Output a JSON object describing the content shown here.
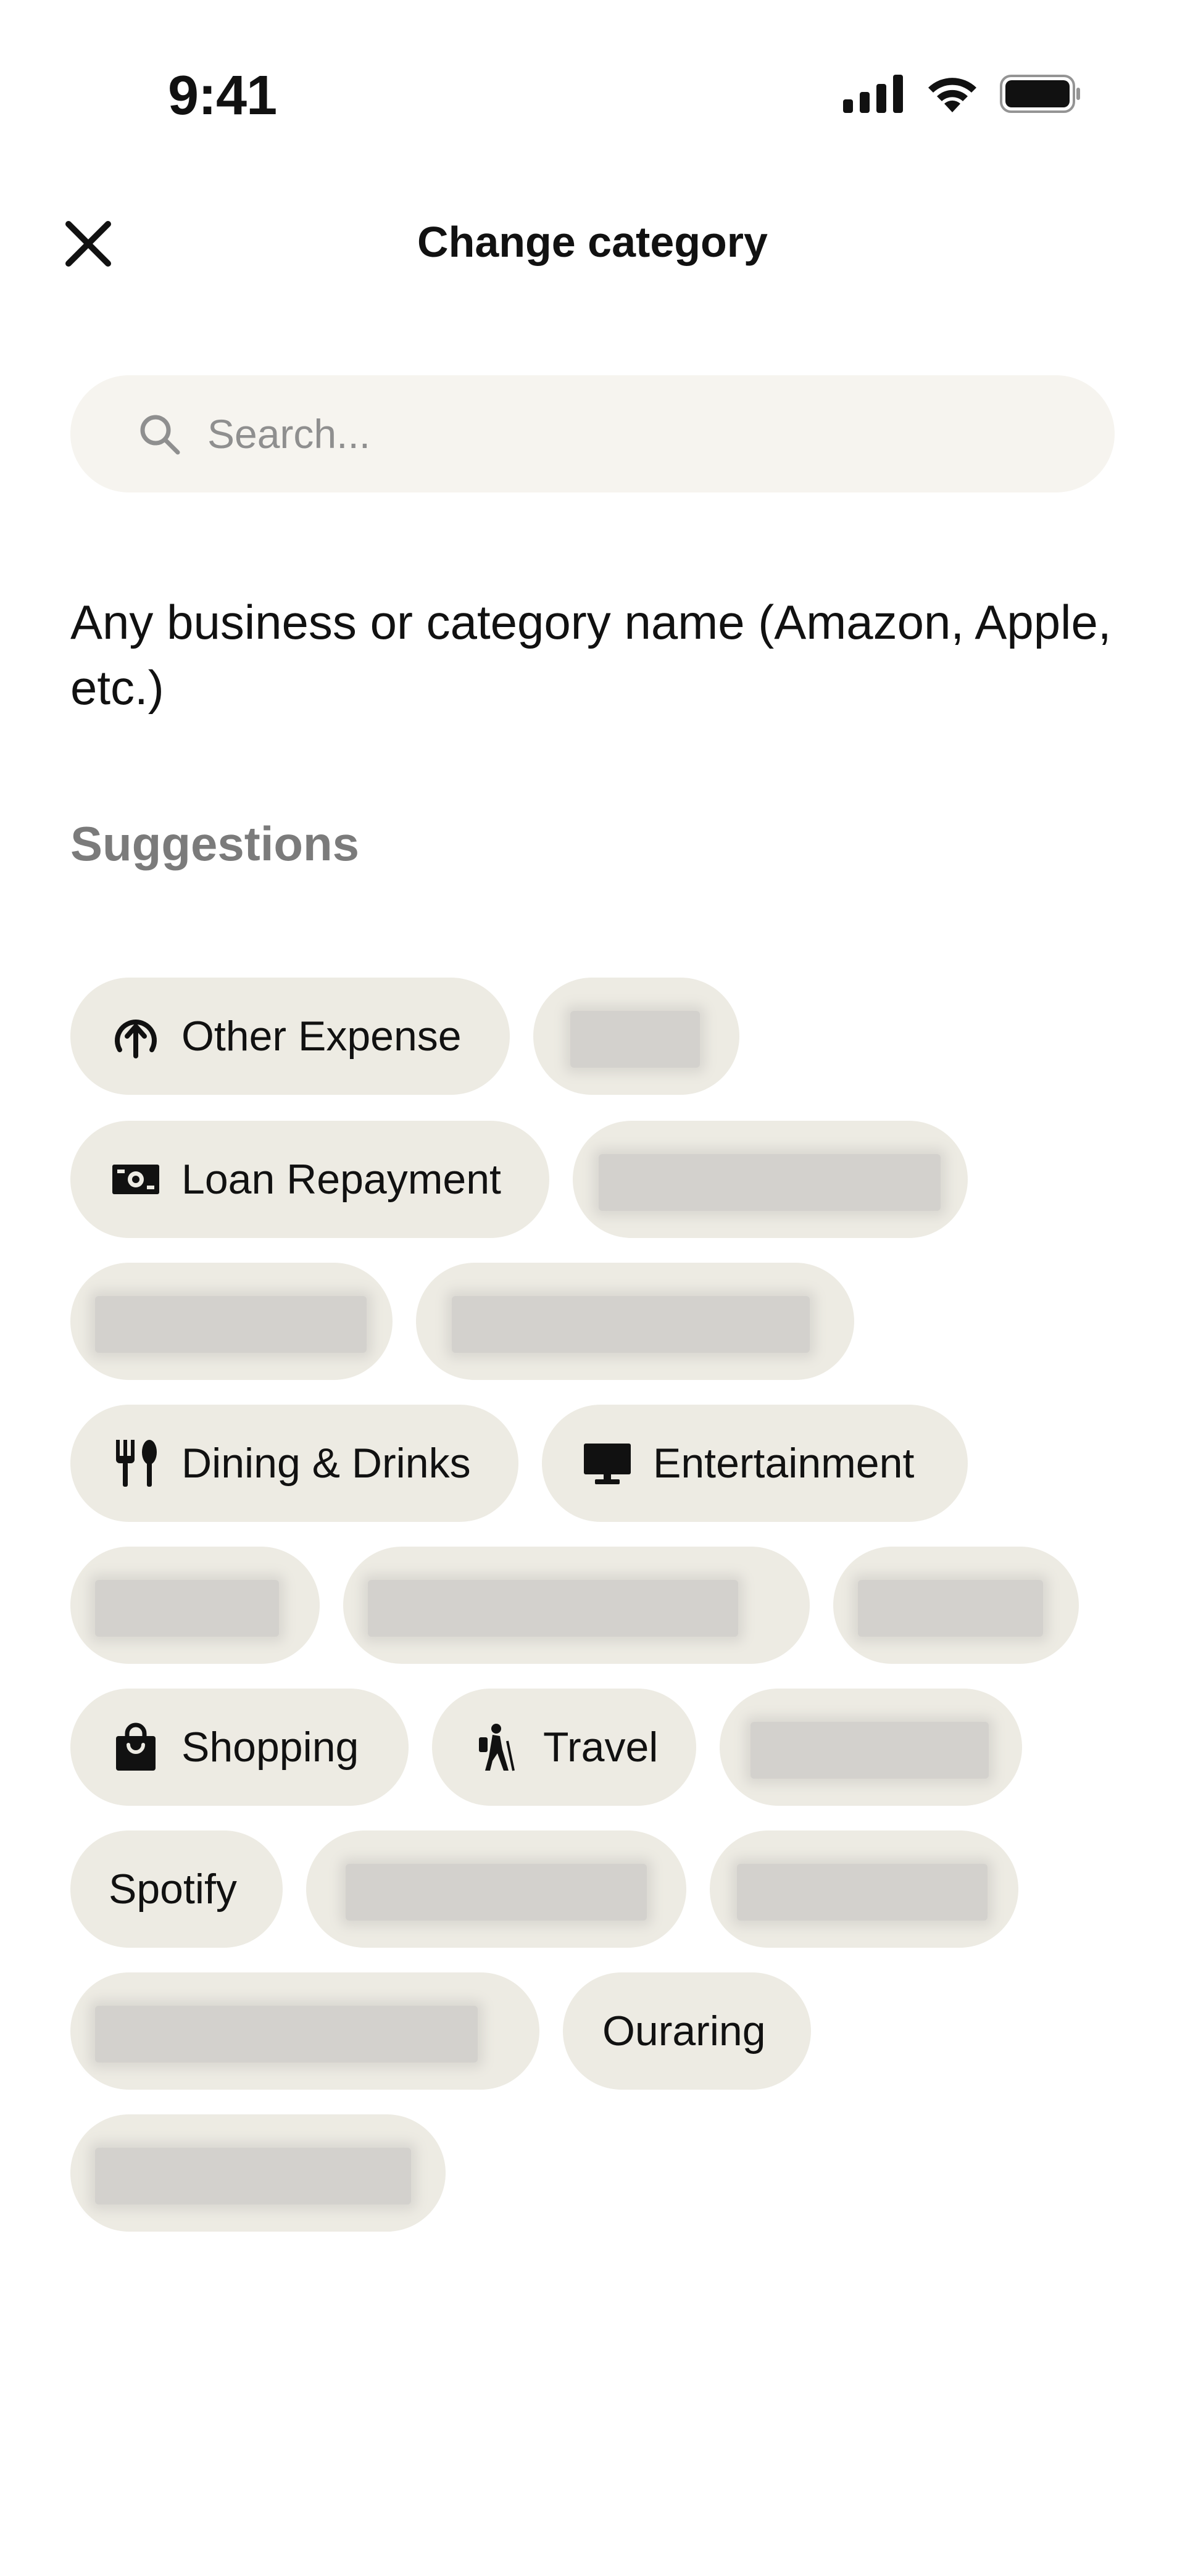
{
  "status_bar": {
    "time": "9:41",
    "icons": [
      "signal-icon",
      "wifi-icon",
      "battery-icon"
    ]
  },
  "header": {
    "close_icon": "close-icon",
    "title": "Change category"
  },
  "search": {
    "placeholder": "Search...",
    "value": "",
    "icon": "search-icon"
  },
  "hint": "Any business or category name (Amazon, Apple, etc.)",
  "suggestions": {
    "heading": "Suggestions",
    "chips": [
      {
        "label": "Other Expense",
        "icon": "arrow-up-circle-icon"
      },
      {
        "label": "Loan Repayment",
        "icon": "money-bill-icon"
      },
      {
        "label": "Dining & Drinks",
        "icon": "fork-knife-icon"
      },
      {
        "label": "Entertainment",
        "icon": "monitor-icon"
      },
      {
        "label": "Shopping",
        "icon": "shopping-bag-icon"
      },
      {
        "label": "Travel",
        "icon": "hiker-icon"
      },
      {
        "label": "Spotify"
      },
      {
        "label": "Ouraring"
      }
    ]
  },
  "colors": {
    "chip_background": "#edebe3",
    "search_background": "#f6f4ef",
    "muted_text": "#7b7b7b"
  }
}
